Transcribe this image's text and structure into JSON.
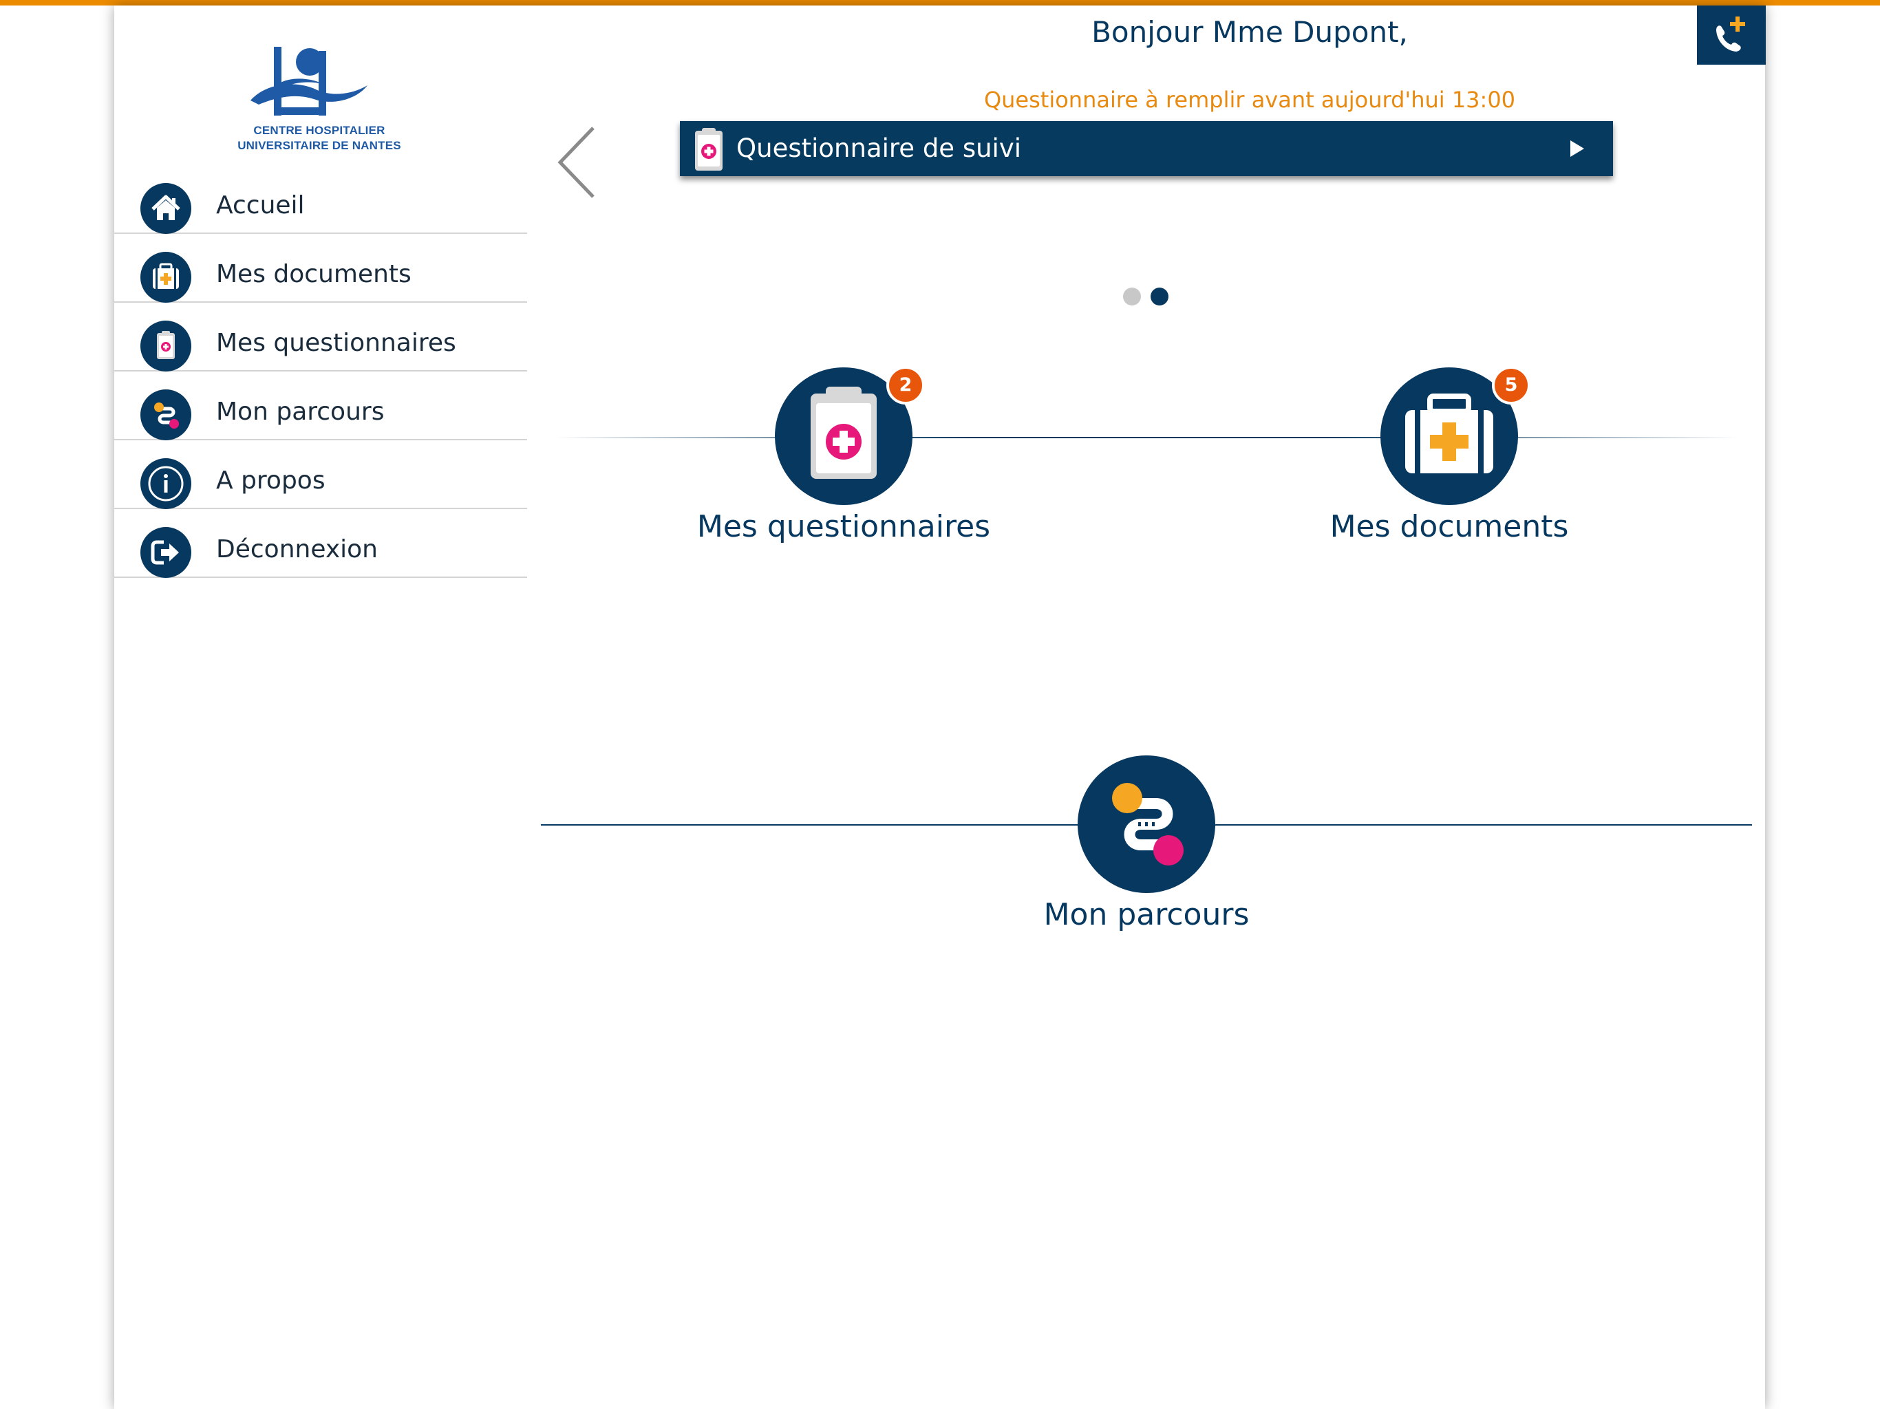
{
  "logo": {
    "line1": "CENTRE HOSPITALIER",
    "line2": "UNIVERSITAIRE DE NANTES"
  },
  "sidebar": {
    "items": [
      {
        "label": "Accueil",
        "icon": "home-icon"
      },
      {
        "label": "Mes documents",
        "icon": "medical-case-icon"
      },
      {
        "label": "Mes questionnaires",
        "icon": "clipboard-icon"
      },
      {
        "label": "Mon parcours",
        "icon": "path-icon"
      },
      {
        "label": "A propos",
        "icon": "info-icon"
      },
      {
        "label": "Déconnexion",
        "icon": "logout-icon"
      }
    ]
  },
  "header": {
    "greeting": "Bonjour Mme Dupont,",
    "deadline": "Questionnaire à remplir avant aujourd'hui 13:00"
  },
  "banner": {
    "title": "Questionnaire de suivi"
  },
  "carousel": {
    "total_pages": 2,
    "active_page": 2
  },
  "tiles": {
    "questionnaires": {
      "label": "Mes questionnaires",
      "badge": "2"
    },
    "documents": {
      "label": "Mes documents",
      "badge": "5"
    },
    "parcours": {
      "label": "Mon parcours"
    }
  },
  "colors": {
    "navy": "#07385f",
    "orange_accent": "#ed8b00",
    "deadline_text": "#e88a10",
    "badge": "#e8560b",
    "pink": "#e6197a",
    "yellow": "#f5a623"
  }
}
